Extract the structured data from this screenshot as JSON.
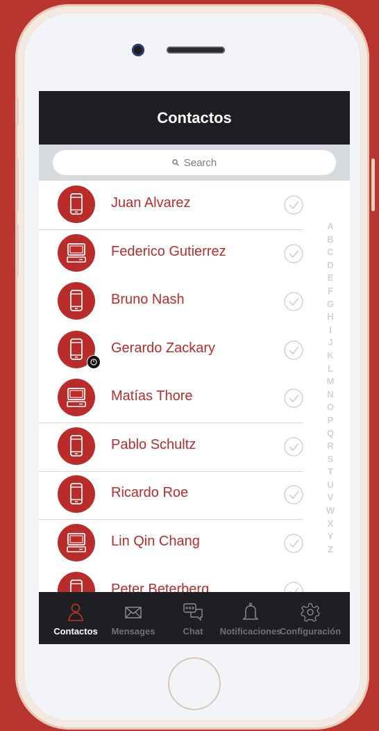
{
  "header": {
    "title": "Contactos"
  },
  "search": {
    "placeholder": "Search"
  },
  "contacts": [
    {
      "name_strong": "Juan Alvarez",
      "name_light": "",
      "device": "phone-icon",
      "divider": true,
      "badge": false
    },
    {
      "name_strong": "Federico Gutierrez",
      "name_light": "",
      "device": "computer-icon",
      "divider": false,
      "badge": false
    },
    {
      "name_strong": "",
      "name_light": "Bruno Nash",
      "device": "phone-icon",
      "divider": false,
      "badge": false
    },
    {
      "name_strong": "Gerardo",
      "name_light": " Zackary",
      "device": "phone-icon",
      "divider": false,
      "badge": true
    },
    {
      "name_strong": "Matías",
      "name_light": " Thore",
      "device": "computer-icon",
      "divider": true,
      "badge": false
    },
    {
      "name_strong": "",
      "name_light": "Pablo Schultz",
      "device": "phone-icon",
      "divider": true,
      "badge": false
    },
    {
      "name_strong": "",
      "name_light": "Ricardo Roe",
      "device": "phone-icon",
      "divider": true,
      "badge": false
    },
    {
      "name_strong": "",
      "name_light": "Lin Qin Chang",
      "device": "computer-icon",
      "divider": false,
      "badge": false
    },
    {
      "name_strong": "",
      "name_light": "Peter Beterberg",
      "device": "phone-icon",
      "divider": false,
      "badge": false
    }
  ],
  "alphabet": [
    "A",
    "B",
    "C",
    "D",
    "E",
    "F",
    "G",
    "H",
    "I",
    "J",
    "K",
    "L",
    "M",
    "N",
    "O",
    "P",
    "Q",
    "R",
    "S",
    "T",
    "U",
    "V",
    "W",
    "X",
    "Y",
    "Z"
  ],
  "tabs": [
    {
      "label": "Contactos",
      "icon": "user-icon",
      "active": true
    },
    {
      "label": "Mensages",
      "icon": "envelope-icon",
      "active": false
    },
    {
      "label": "Chat",
      "icon": "chat-icon",
      "active": false
    },
    {
      "label": "Notificaciones",
      "icon": "bell-icon",
      "active": false
    },
    {
      "label": "Configuración",
      "icon": "gear-icon",
      "active": false
    }
  ],
  "colors": {
    "background": "#b93530",
    "accent": "#b92c2a",
    "header": "#1d1f23",
    "search_bar": "#d7dbe0",
    "tab_inactive": "#6d7078",
    "index_letters": "#cfd2d8"
  }
}
